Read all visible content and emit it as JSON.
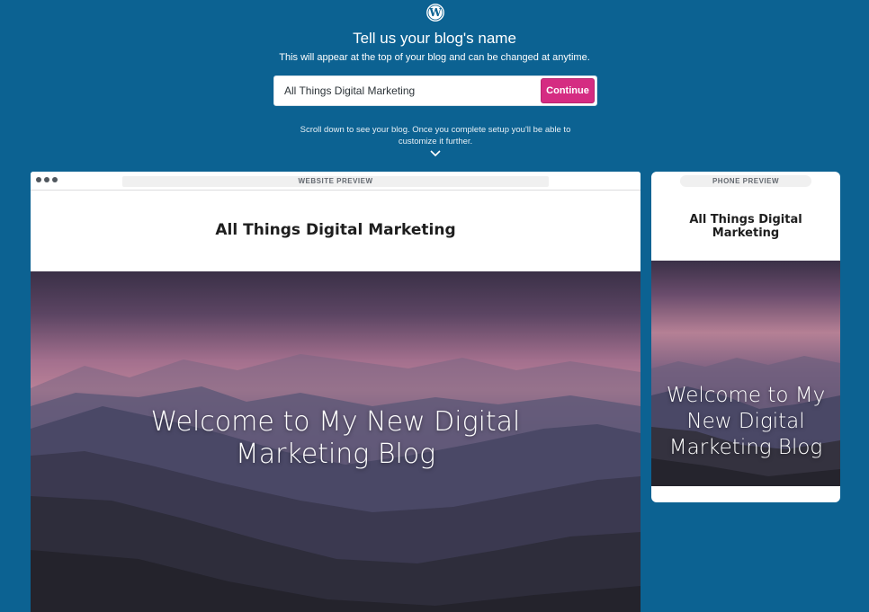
{
  "header": {
    "logo_icon": "wordpress-logo-icon",
    "title": "Tell us your blog's name",
    "subtitle": "This will appear at the top of your blog and can be changed at anytime."
  },
  "form": {
    "input_value": "All Things Digital Marketing",
    "continue_label": "Continue"
  },
  "scroll_hint": "Scroll down to see your blog. Once you complete setup you'll be able to customize it further.",
  "scroll_icon": "chevron-down-icon",
  "desktop_preview": {
    "label": "WEBSITE PREVIEW",
    "site_title": "All Things Digital Marketing",
    "hero_heading": "Welcome to My New Digital Marketing Blog"
  },
  "phone_preview": {
    "label": "PHONE PREVIEW",
    "site_title": "All Things Digital Marketing",
    "hero_heading": "Welcome to My New Digital Marketing Blog"
  },
  "colors": {
    "background": "#0c6292",
    "accent": "#d52c82"
  }
}
